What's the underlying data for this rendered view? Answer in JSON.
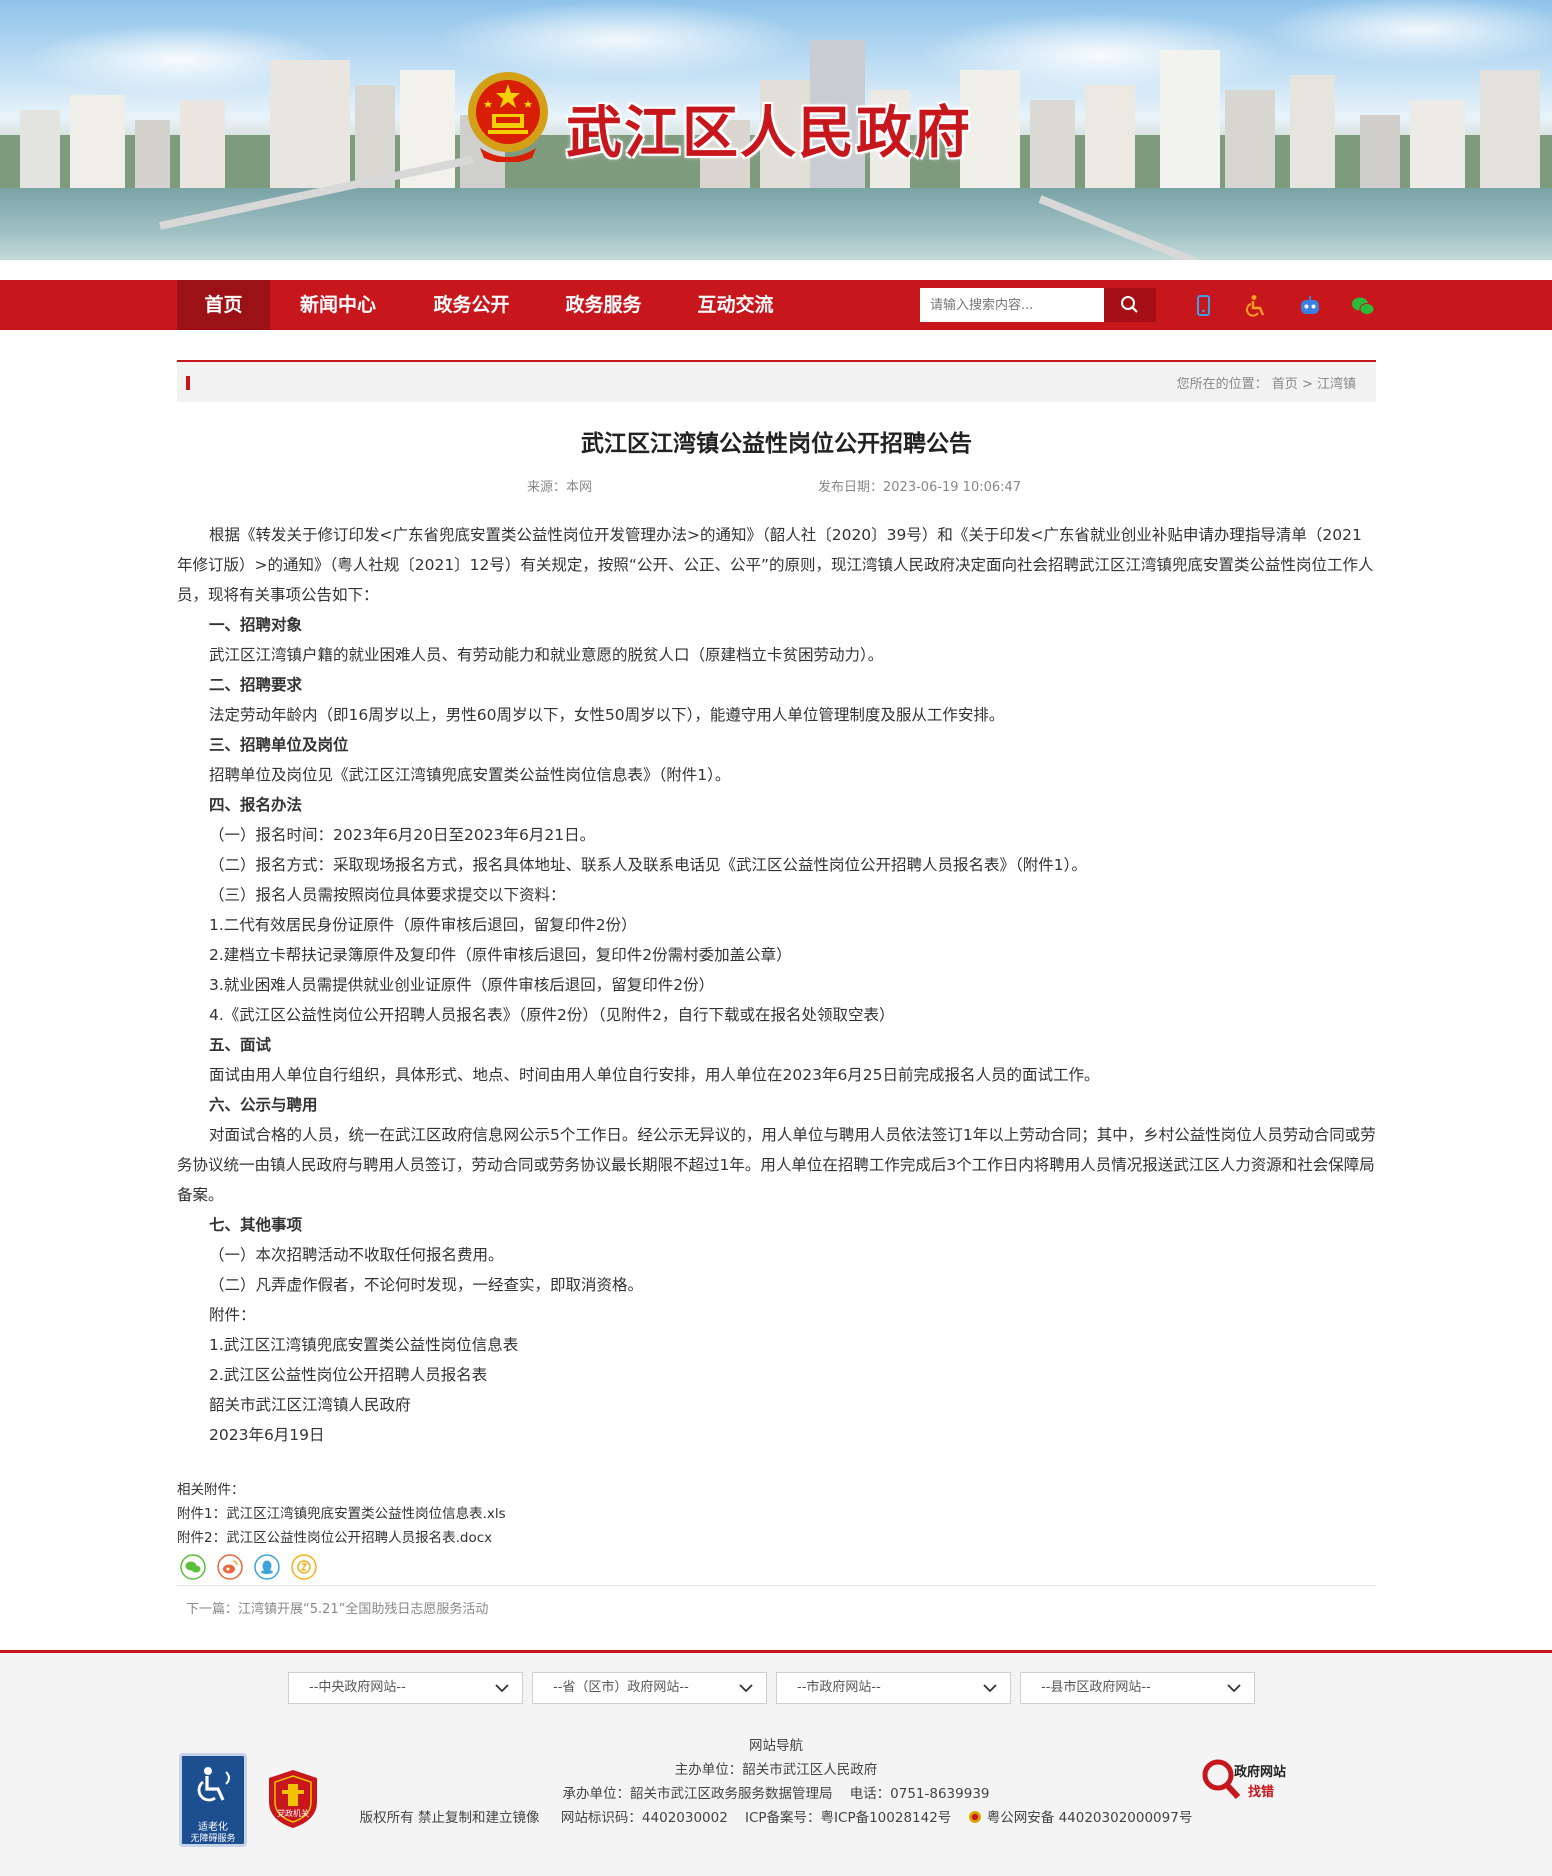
{
  "header": {
    "site_title": "武江区人民政府"
  },
  "nav": {
    "items": [
      {
        "label": "首页",
        "active": true
      },
      {
        "label": "新闻中心",
        "active": false
      },
      {
        "label": "政务公开",
        "active": false
      },
      {
        "label": "政务服务",
        "active": false
      },
      {
        "label": "互动交流",
        "active": false
      }
    ],
    "search_placeholder": "请输入搜索内容...",
    "tools": [
      "mobile-icon",
      "accessibility-icon",
      "robot-icon",
      "wechat-icon"
    ]
  },
  "breadcrumb": {
    "prefix": "您所在的位置：",
    "home": "首页",
    "sep": ">",
    "current": "江湾镇"
  },
  "article": {
    "title": "武江区江湾镇公益性岗位公开招聘公告",
    "source": "来源：本网",
    "date": "发布日期：2023-06-19 10:06:47",
    "intro": "根据《转发关于修订印发<广东省兜底安置类公益性岗位开发管理办法>的通知》（韶人社〔2020〕39号）和《关于印发<广东省就业创业补贴申请办理指导清单（2021年修订版）>的通知》（粤人社规〔2021〕12号）有关规定，按照“公开、公正、公平”的原则，现江湾镇人民政府决定面向社会招聘武江区江湾镇兜底安置类公益性岗位工作人员，现将有关事项公告如下：",
    "s1_title": "一、招聘对象",
    "s1_body": "武江区江湾镇户籍的就业困难人员、有劳动能力和就业意愿的脱贫人口（原建档立卡贫困劳动力）。",
    "s2_title": "二、招聘要求",
    "s2_body": "法定劳动年龄内（即16周岁以上，男性60周岁以下，女性50周岁以下），能遵守用人单位管理制度及服从工作安排。",
    "s3_title": "三、招聘单位及岗位",
    "s3_body": "招聘单位及岗位见《武江区江湾镇兜底安置类公益性岗位信息表》（附件1）。",
    "s4_title": "四、报名办法",
    "s4_l1": "（一）报名时间：2023年6月20日至2023年6月21日。",
    "s4_l2": "（二）报名方式：采取现场报名方式，报名具体地址、联系人及联系电话见《武江区公益性岗位公开招聘人员报名表》（附件1）。",
    "s4_l3": "（三）报名人员需按照岗位具体要求提交以下资料：",
    "s4_l4": "1.二代有效居民身份证原件（原件审核后退回，留复印件2份）",
    "s4_l5": "2.建档立卡帮扶记录簿原件及复印件（原件审核后退回，复印件2份需村委加盖公章）",
    "s4_l6": "3.就业困难人员需提供就业创业证原件（原件审核后退回，留复印件2份）",
    "s4_l7": "4.《武江区公益性岗位公开招聘人员报名表》（原件2份）（见附件2，自行下载或在报名处领取空表）",
    "s5_title": "五、面试",
    "s5_body": "面试由用人单位自行组织，具体形式、地点、时间由用人单位自行安排，用人单位在2023年6月25日前完成报名人员的面试工作。",
    "s6_title": "六、公示与聘用",
    "s6_body": "对面试合格的人员，统一在武江区政府信息网公示5个工作日。经公示无异议的，用人单位与聘用人员依法签订1年以上劳动合同；其中，乡村公益性岗位人员劳动合同或劳务协议统一由镇人民政府与聘用人员签订，劳动合同或劳务协议最长期限不超过1年。用人单位在招聘工作完成后3个工作日内将聘用人员情况报送武江区人力资源和社会保障局备案。",
    "s7_title": "七、其他事项",
    "s7_l1": "（一）本次招聘活动不收取任何报名费用。",
    "s7_l2": "（二）凡弄虚作假者，不论何时发现，一经查实，即取消资格。",
    "att_head": "附件：",
    "att_1": "1.武江区江湾镇兜底安置类公益性岗位信息表",
    "att_2": "2.武江区公益性岗位公开招聘人员报名表",
    "sign_org": "韶关市武江区江湾镇人民政府",
    "sign_date": "2023年6月19日"
  },
  "attachments": {
    "label": "相关附件：",
    "file1": "附件1：武江区江湾镇兜底安置类公益性岗位信息表.xls",
    "file2": "附件2：武江区公益性岗位公开招聘人员报名表.docx"
  },
  "share": [
    "wechat-share-icon",
    "weibo-share-icon",
    "qq-share-icon",
    "qzone-share-icon"
  ],
  "next_article": "下一篇：江湾镇开展“5.21”全国助残日志愿服务活动",
  "footer": {
    "selects": [
      "--中央政府网站--",
      "--省（区市）政府网站--",
      "--市政府网站--",
      "--县市区政府网站--"
    ],
    "nav_link": "网站导航",
    "sponsor": "主办单位：韶关市武江区人民政府",
    "organizer": "承办单位：韶关市武江区政务服务数据管理局",
    "phone": "电话：0751-8639939",
    "copyright": "版权所有 禁止复制和建立镜像",
    "site_code": "网站标识码：4402030002",
    "icp": "ICP备案号：粤ICP备10028142号",
    "police": "粤公网安备 44020302000097号",
    "a11y_line1": "适老化",
    "a11y_line2": "无障碍服务",
    "party_label": "党政机关",
    "err_line1": "政府网站",
    "err_line2": "找错"
  },
  "colors": {
    "brand_red": "#c8161d",
    "nav_active": "#9b1116"
  }
}
